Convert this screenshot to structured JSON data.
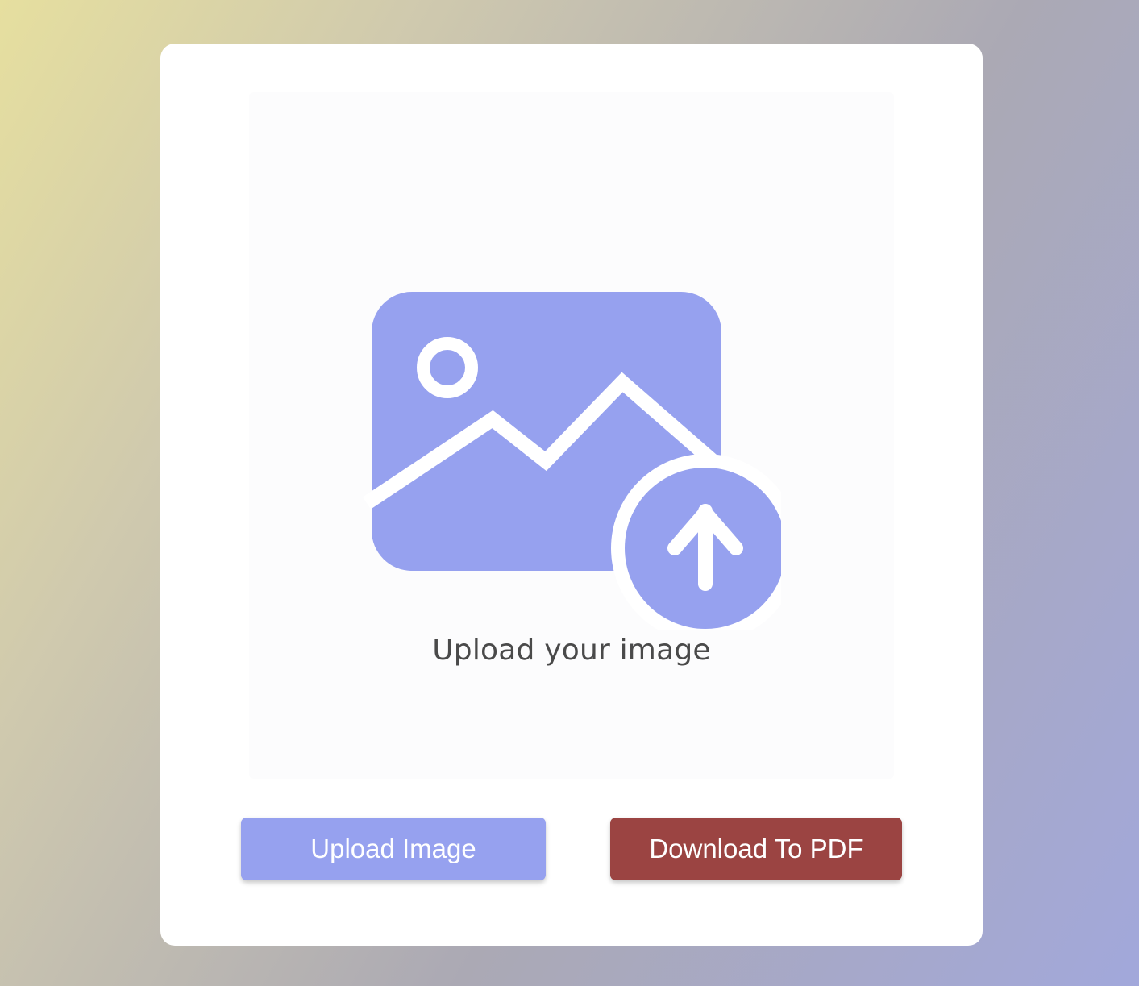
{
  "upload_area": {
    "icon": "image-upload-icon",
    "caption": "Upload your image"
  },
  "buttons": {
    "upload_label": "Upload Image",
    "download_label": "Download To PDF"
  },
  "colors": {
    "accent": "#96a1ef",
    "download": "#9b4442",
    "card": "#ffffff"
  }
}
